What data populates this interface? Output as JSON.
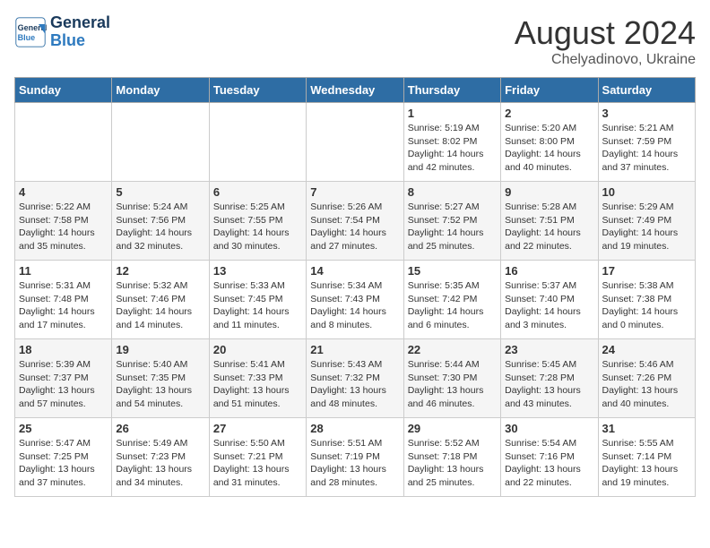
{
  "header": {
    "logo_line1": "General",
    "logo_line2": "Blue",
    "month_year": "August 2024",
    "location": "Chelyadinovo, Ukraine"
  },
  "weekdays": [
    "Sunday",
    "Monday",
    "Tuesday",
    "Wednesday",
    "Thursday",
    "Friday",
    "Saturday"
  ],
  "weeks": [
    [
      {
        "day": "",
        "info": ""
      },
      {
        "day": "",
        "info": ""
      },
      {
        "day": "",
        "info": ""
      },
      {
        "day": "",
        "info": ""
      },
      {
        "day": "1",
        "info": "Sunrise: 5:19 AM\nSunset: 8:02 PM\nDaylight: 14 hours\nand 42 minutes."
      },
      {
        "day": "2",
        "info": "Sunrise: 5:20 AM\nSunset: 8:00 PM\nDaylight: 14 hours\nand 40 minutes."
      },
      {
        "day": "3",
        "info": "Sunrise: 5:21 AM\nSunset: 7:59 PM\nDaylight: 14 hours\nand 37 minutes."
      }
    ],
    [
      {
        "day": "4",
        "info": "Sunrise: 5:22 AM\nSunset: 7:58 PM\nDaylight: 14 hours\nand 35 minutes."
      },
      {
        "day": "5",
        "info": "Sunrise: 5:24 AM\nSunset: 7:56 PM\nDaylight: 14 hours\nand 32 minutes."
      },
      {
        "day": "6",
        "info": "Sunrise: 5:25 AM\nSunset: 7:55 PM\nDaylight: 14 hours\nand 30 minutes."
      },
      {
        "day": "7",
        "info": "Sunrise: 5:26 AM\nSunset: 7:54 PM\nDaylight: 14 hours\nand 27 minutes."
      },
      {
        "day": "8",
        "info": "Sunrise: 5:27 AM\nSunset: 7:52 PM\nDaylight: 14 hours\nand 25 minutes."
      },
      {
        "day": "9",
        "info": "Sunrise: 5:28 AM\nSunset: 7:51 PM\nDaylight: 14 hours\nand 22 minutes."
      },
      {
        "day": "10",
        "info": "Sunrise: 5:29 AM\nSunset: 7:49 PM\nDaylight: 14 hours\nand 19 minutes."
      }
    ],
    [
      {
        "day": "11",
        "info": "Sunrise: 5:31 AM\nSunset: 7:48 PM\nDaylight: 14 hours\nand 17 minutes."
      },
      {
        "day": "12",
        "info": "Sunrise: 5:32 AM\nSunset: 7:46 PM\nDaylight: 14 hours\nand 14 minutes."
      },
      {
        "day": "13",
        "info": "Sunrise: 5:33 AM\nSunset: 7:45 PM\nDaylight: 14 hours\nand 11 minutes."
      },
      {
        "day": "14",
        "info": "Sunrise: 5:34 AM\nSunset: 7:43 PM\nDaylight: 14 hours\nand 8 minutes."
      },
      {
        "day": "15",
        "info": "Sunrise: 5:35 AM\nSunset: 7:42 PM\nDaylight: 14 hours\nand 6 minutes."
      },
      {
        "day": "16",
        "info": "Sunrise: 5:37 AM\nSunset: 7:40 PM\nDaylight: 14 hours\nand 3 minutes."
      },
      {
        "day": "17",
        "info": "Sunrise: 5:38 AM\nSunset: 7:38 PM\nDaylight: 14 hours\nand 0 minutes."
      }
    ],
    [
      {
        "day": "18",
        "info": "Sunrise: 5:39 AM\nSunset: 7:37 PM\nDaylight: 13 hours\nand 57 minutes."
      },
      {
        "day": "19",
        "info": "Sunrise: 5:40 AM\nSunset: 7:35 PM\nDaylight: 13 hours\nand 54 minutes."
      },
      {
        "day": "20",
        "info": "Sunrise: 5:41 AM\nSunset: 7:33 PM\nDaylight: 13 hours\nand 51 minutes."
      },
      {
        "day": "21",
        "info": "Sunrise: 5:43 AM\nSunset: 7:32 PM\nDaylight: 13 hours\nand 48 minutes."
      },
      {
        "day": "22",
        "info": "Sunrise: 5:44 AM\nSunset: 7:30 PM\nDaylight: 13 hours\nand 46 minutes."
      },
      {
        "day": "23",
        "info": "Sunrise: 5:45 AM\nSunset: 7:28 PM\nDaylight: 13 hours\nand 43 minutes."
      },
      {
        "day": "24",
        "info": "Sunrise: 5:46 AM\nSunset: 7:26 PM\nDaylight: 13 hours\nand 40 minutes."
      }
    ],
    [
      {
        "day": "25",
        "info": "Sunrise: 5:47 AM\nSunset: 7:25 PM\nDaylight: 13 hours\nand 37 minutes."
      },
      {
        "day": "26",
        "info": "Sunrise: 5:49 AM\nSunset: 7:23 PM\nDaylight: 13 hours\nand 34 minutes."
      },
      {
        "day": "27",
        "info": "Sunrise: 5:50 AM\nSunset: 7:21 PM\nDaylight: 13 hours\nand 31 minutes."
      },
      {
        "day": "28",
        "info": "Sunrise: 5:51 AM\nSunset: 7:19 PM\nDaylight: 13 hours\nand 28 minutes."
      },
      {
        "day": "29",
        "info": "Sunrise: 5:52 AM\nSunset: 7:18 PM\nDaylight: 13 hours\nand 25 minutes."
      },
      {
        "day": "30",
        "info": "Sunrise: 5:54 AM\nSunset: 7:16 PM\nDaylight: 13 hours\nand 22 minutes."
      },
      {
        "day": "31",
        "info": "Sunrise: 5:55 AM\nSunset: 7:14 PM\nDaylight: 13 hours\nand 19 minutes."
      }
    ]
  ]
}
